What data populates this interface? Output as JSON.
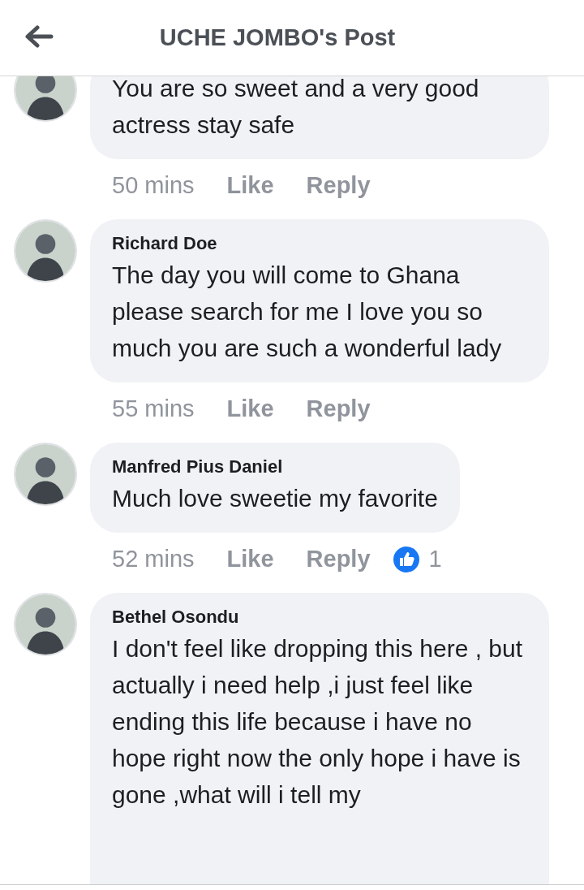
{
  "header": {
    "title": "UCHE JOMBO's Post"
  },
  "comments": [
    {
      "text": "You are so sweet and a very good actress stay safe",
      "time": "50 mins",
      "like": "Like",
      "reply": "Reply"
    },
    {
      "author": "Richard Doe",
      "text": "The day you will come to Ghana please search for me I love you so much you are such a wonderful lady",
      "time": "55 mins",
      "like": "Like",
      "reply": "Reply"
    },
    {
      "author": "Manfred Pius Daniel",
      "text": "Much love sweetie my favorite",
      "time": "52 mins",
      "like": "Like",
      "reply": "Reply",
      "reactions": "1"
    },
    {
      "author": "Bethel Osondu",
      "text": "I don't feel like dropping this here , but actually i need help ,i just feel like ending this life because i have no hope right now the only hope i have is gone ,what will i tell my"
    }
  ]
}
